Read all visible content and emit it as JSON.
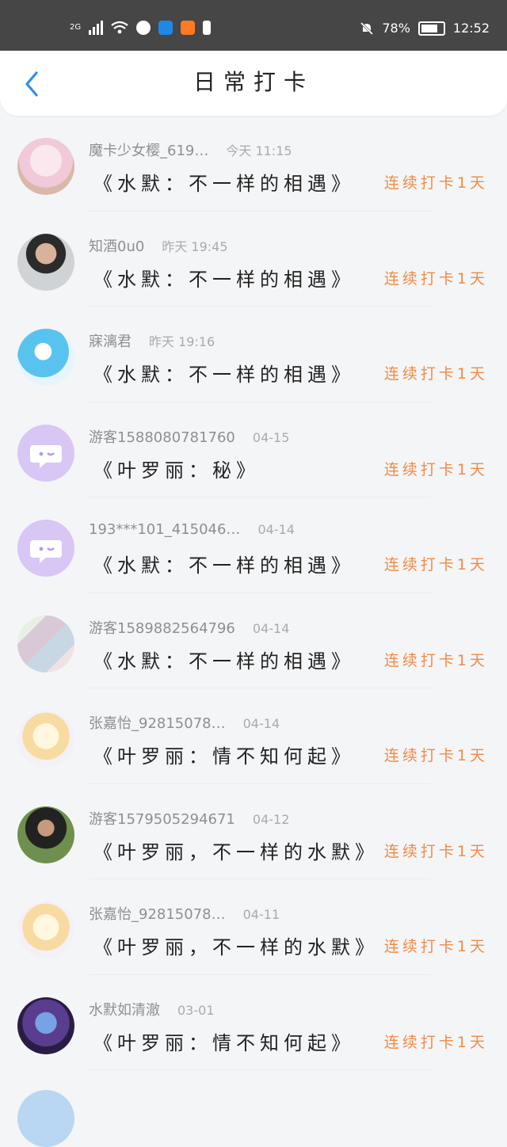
{
  "status_bar": {
    "network": "2G",
    "battery": "78%",
    "time": "12:52"
  },
  "header": {
    "title": "日常打卡",
    "back_icon": "chevron-left-icon"
  },
  "colors": {
    "accent": "#f08b46",
    "back": "#2d8ff0"
  },
  "entries": [
    {
      "user": "魔卡少女樱_619…",
      "time": "今天 11:15",
      "book": "《水默：不一样的相遇》",
      "streak": "连续打卡1天",
      "avatar": "avatar-anime-pink"
    },
    {
      "user": "知酒0u0",
      "time": "昨天 19:45",
      "book": "《水默：不一样的相遇》",
      "streak": "连续打卡1天",
      "avatar": "avatar-photo-man"
    },
    {
      "user": "寐漓君",
      "time": "昨天 19:16",
      "book": "《水默：不一样的相遇》",
      "streak": "连续打卡1天",
      "avatar": "avatar-anime-blue"
    },
    {
      "user": "游客1588080781760",
      "time": "04-15",
      "book": "《叶罗丽：秘》",
      "streak": "连续打卡1天",
      "avatar": "avatar-default-chat"
    },
    {
      "user": "193***101_415046…",
      "time": "04-14",
      "book": "《水默：不一样的相遇》",
      "streak": "连续打卡1天",
      "avatar": "avatar-default-chat"
    },
    {
      "user": "游客1589882564796",
      "time": "04-14",
      "book": "《水默：不一样的相遇》",
      "streak": "连续打卡1天",
      "avatar": "avatar-collage"
    },
    {
      "user": "张嘉怡_92815078…",
      "time": "04-14",
      "book": "《叶罗丽：情不知何起》",
      "streak": "连续打卡1天",
      "avatar": "avatar-cartoon-girl"
    },
    {
      "user": "游客1579505294671",
      "time": "04-12",
      "book": "《叶罗丽，不一样的水默》",
      "streak": "连续打卡1天",
      "avatar": "avatar-photo-child"
    },
    {
      "user": "张嘉怡_92815078…",
      "time": "04-11",
      "book": "《叶罗丽，不一样的水默》",
      "streak": "连续打卡1天",
      "avatar": "avatar-cartoon-girl"
    },
    {
      "user": "水默如清澈",
      "time": "03-01",
      "book": "《叶罗丽：情不知何起》",
      "streak": "连续打卡1天",
      "avatar": "avatar-anime-couple"
    }
  ]
}
